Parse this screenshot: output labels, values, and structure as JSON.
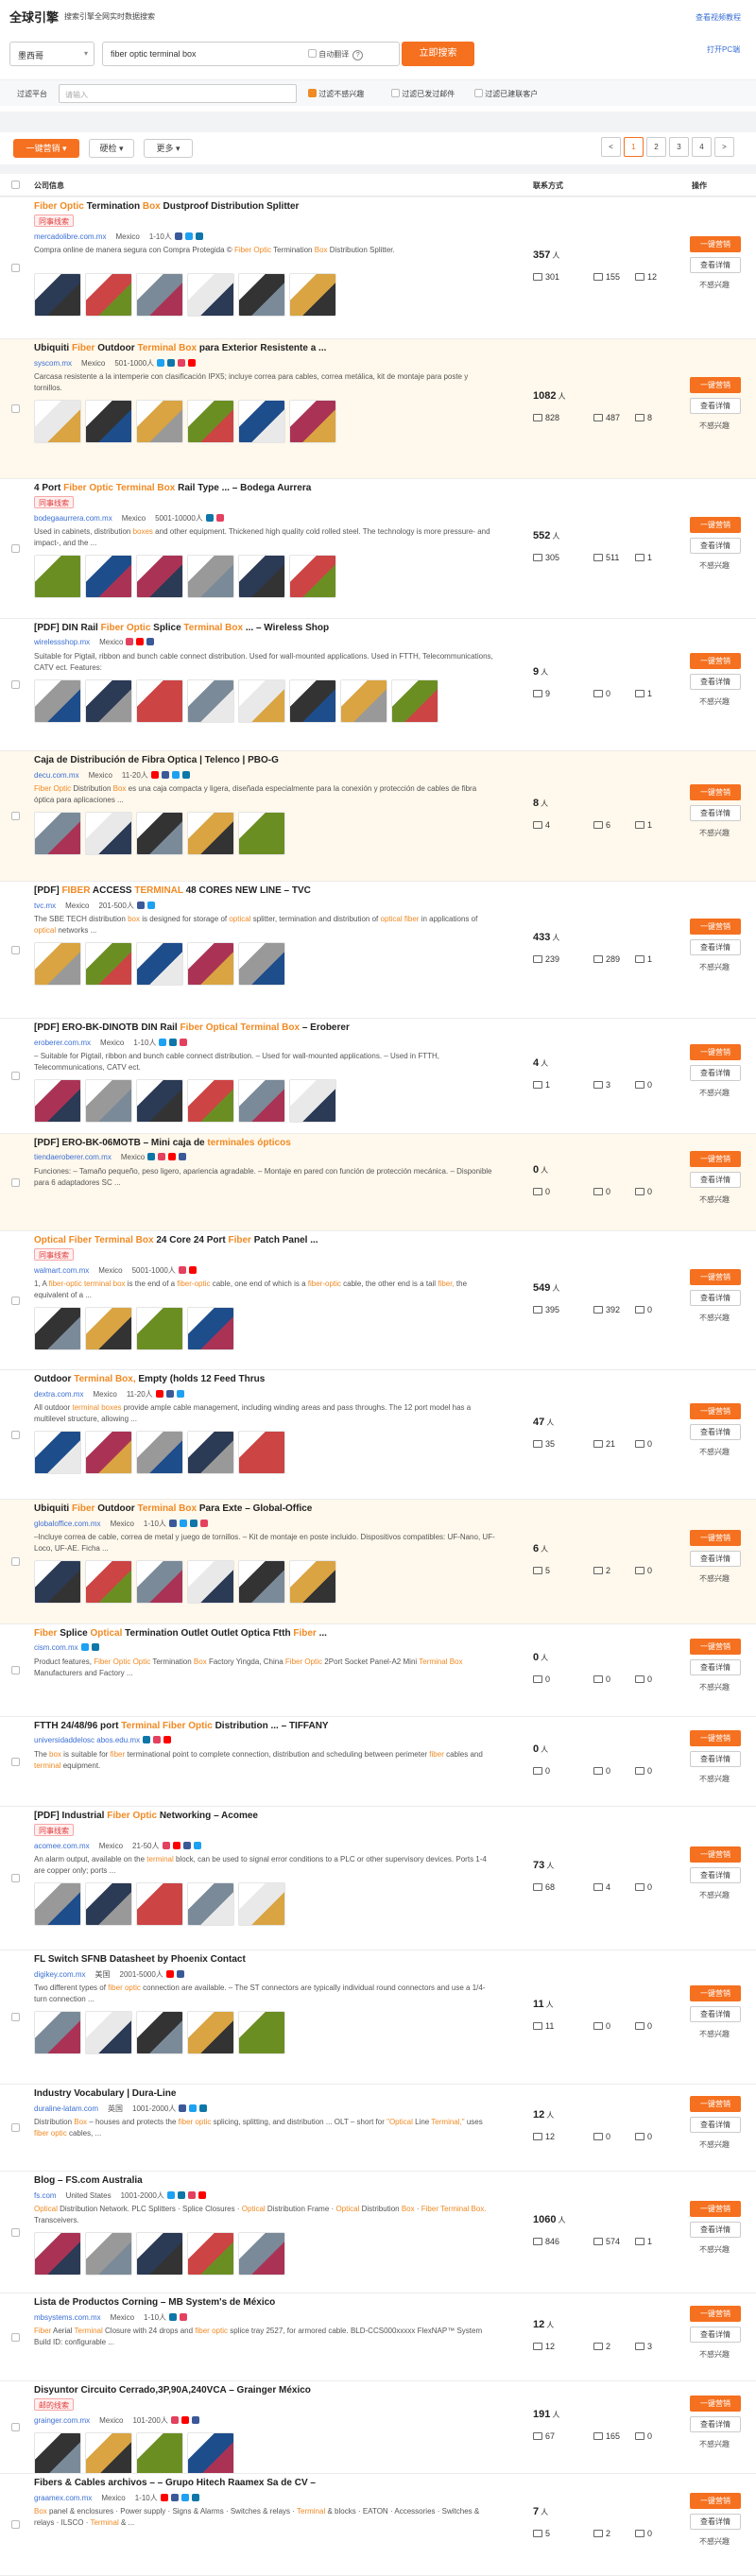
{
  "brand": "全球引擎",
  "brand_sub": "搜索引擎全网实时数据搜索",
  "top_links": {
    "tutorial": "查看视频教程",
    "open_pc": "打开PC端"
  },
  "search": {
    "country": "墨西哥",
    "keyword": "fiber optic terminal box",
    "auto_translate": "自动翻译",
    "button": "立即搜索"
  },
  "filter": {
    "label": "过滤平台",
    "placeholder": "请输入",
    "opt1": "过滤不感兴趣",
    "opt2": "过滤已发过邮件",
    "opt3": "过滤已建联客户"
  },
  "toolbar": {
    "marketing": "一键营销",
    "hard_check": "硬检",
    "more": "更多",
    "pages": [
      "1",
      "2",
      "3",
      "4"
    ],
    "prev": "<",
    "next": ">"
  },
  "table_head": {
    "company": "公司信息",
    "contact": "联系方式",
    "action": "操作"
  },
  "actions": {
    "marketing": "一键营销",
    "view": "查看详情",
    "uninterested": "不感兴趣"
  },
  "count_unit": "人",
  "rows": [
    {
      "title": "Fiber Optic Termination Box Dustproof Distribution Splitter",
      "tag": "同事线索",
      "domain": "mercadolibre.com.mx",
      "country": "Mexico",
      "size": "1-10人",
      "desc": "Compra online de manera segura con Compra Protegida © Fiber Optic Termination Box Distribution Splitter.",
      "count": "357",
      "emails": "301",
      "phones": "155",
      "links": "12"
    },
    {
      "title": "Ubiquiti Fiber Outdoor Terminal Box para Exterior Resistente a ...",
      "tag": "",
      "domain": "syscom.mx",
      "country": "Mexico",
      "size": "501-1000人",
      "desc": "Carcasa resistente a la intemperie con clasificación IPX5; incluye correa para cables, correa metálica, kit de montaje para poste y tornillos.",
      "count": "1082",
      "emails": "828",
      "phones": "487",
      "links": "8"
    },
    {
      "title": "4 Port Fiber Optic Terminal Box Rail Type ... – Bodega Aurrera",
      "tag": "同事线索",
      "domain": "bodegaaurrera.com.mx",
      "country": "Mexico",
      "size": "5001-10000人",
      "desc": "Used in cabinets, distribution boxes and other equipment. Thickened high quality cold rolled steel. The technology is more pressure- and impact-, and the ...",
      "count": "552",
      "emails": "305",
      "phones": "511",
      "links": "1"
    },
    {
      "title": "[PDF] DIN Rail Fiber Optic Splice Terminal Box ... – Wireless Shop",
      "tag": "",
      "domain": "wirelessshop.mx",
      "country": "Mexico",
      "size": "",
      "desc": "Suitable for Pigtail, ribbon and bunch cable connect distribution. Used for wall-mounted applications. Used in FTTH, Telecommunications, CATV ect. Features:",
      "count": "9",
      "emails": "9",
      "phones": "0",
      "links": "1"
    },
    {
      "title": "Caja de Distribución de Fibra Óptica | Telenco | PBO-G",
      "tag": "",
      "domain": "decu.com.mx",
      "country": "Mexico",
      "size": "11-20人",
      "desc": "Fiber Optic Distribution Box es una caja compacta y ligera, diseñada especialmente para la conexión y protección de cables de fibra óptica para aplicaciones ...",
      "count": "8",
      "emails": "4",
      "phones": "6",
      "links": "1"
    },
    {
      "title": "[PDF] FIBER ACCESS TERMINAL 48 CORES NEW LINE – TVC",
      "tag": "",
      "domain": "tvc.mx",
      "country": "Mexico",
      "size": "201-500人",
      "desc": "The SBE TECH distribution box is designed for storage of optical splitter, termination and distribution of optical fiber in applications of optical networks ...",
      "count": "433",
      "emails": "239",
      "phones": "289",
      "links": "1"
    },
    {
      "title": "[PDF] ERO-BK-DINOTB DIN Rail Fiber Optical Terminal Box – Eroberer",
      "tag": "",
      "domain": "eroberer.com.mx",
      "country": "Mexico",
      "size": "1-10人",
      "desc": "– Suitable for Pigtail, ribbon and bunch cable connect distribution. – Used for wall-mounted applications. – Used in FTTH, Telecommunications, CATV ect.",
      "count": "4",
      "emails": "1",
      "phones": "3",
      "links": "0"
    },
    {
      "title": "[PDF] ERO-BK-06MOTB – Mini caja de terminales ópticos",
      "tag": "",
      "domain": "tiendaeroberer.com.mx",
      "country": "Mexico",
      "size": "",
      "desc": "Funciones: – Tamaño pequeño, peso ligero, apariencia agradable. – Montaje en pared con función de protección mecánica. – Disponible para 6 adaptadores SC ...",
      "count": "0",
      "emails": "0",
      "phones": "0",
      "links": "0"
    },
    {
      "title": "Optical Fiber Terminal Box 24 Core 24 Port Fiber Patch Panel ...",
      "tag": "同事线索",
      "domain": "walmart.com.mx",
      "country": "Mexico",
      "size": "5001-1000人",
      "desc": "1, A fiber-optic terminal box is the end of a fiber-optic cable, one end of which is a fiber-optic cable, the other end is a tail fiber, the equivalent of a ...",
      "count": "549",
      "emails": "395",
      "phones": "392",
      "links": "0"
    },
    {
      "title": "Outdoor Terminal Box, Empty (holds 12 Feed Thrus",
      "tag": "",
      "domain": "dextra.com.mx",
      "country": "Mexico",
      "size": "11-20人",
      "desc": "All outdoor terminal boxes provide ample cable management, including winding areas and pass throughs. The 12 port model has a multilevel structure, allowing ...",
      "count": "47",
      "emails": "35",
      "phones": "21",
      "links": "0"
    },
    {
      "title": "Ubiquiti Fiber Outdoor Terminal Box Para Exte – Global-Office",
      "tag": "",
      "domain": "globaloffice.com.mx",
      "country": "Mexico",
      "size": "1-10人",
      "desc": "–Incluye correa de cable, correa de metal y juego de tornillos. – Kit de montaje en poste incluido. Dispositivos compatibles: UF-Nano, UF-Loco, UF-AE. Ficha ...",
      "count": "6",
      "emails": "5",
      "phones": "2",
      "links": "0"
    },
    {
      "title": "Fiber Splice Optical Termination Outlet Outlet Optica Ftth Fiber ...",
      "tag": "",
      "domain": "cism.com.mx",
      "country": "",
      "size": "",
      "desc": "Product features, Fiber Optic Optic Termination Box Factory Yingda, China Fiber Optic 2Port Socket Panel-A2 Mini Terminal Box Manufacturers and Factory ...",
      "count": "0",
      "emails": "0",
      "phones": "0",
      "links": "0"
    },
    {
      "title": "FTTH 24/48/96 port Terminal Fiber Optic Distribution ... – TIFFANY",
      "tag": "",
      "domain": "universidaddelosc abos.edu.mx",
      "country": "",
      "size": "",
      "desc": "The box is suitable for fiber terminational point to complete connection, distribution and scheduling between perimeter fiber cables and terminal equipment.",
      "count": "0",
      "emails": "0",
      "phones": "0",
      "links": "0"
    },
    {
      "title": "[PDF] Industrial Fiber Optic Networking – Acomee",
      "tag": "同事线索",
      "domain": "acomee.com.mx",
      "country": "Mexico",
      "size": "21-50人",
      "desc": "An alarm output, available on the terminal block, can be used to signal error conditions to a PLC or other supervisory devices. Ports 1-4 are copper only; ports ...",
      "count": "73",
      "emails": "68",
      "phones": "4",
      "links": "0"
    },
    {
      "title": "FL Switch SFNB Datasheet by Phoenix Contact",
      "tag": "",
      "domain": "digikey.com.mx",
      "country": "美国",
      "size": "2001-5000人",
      "desc": "Two different types of fiber optic connection are available. – The ST connectors are typically individual round connectors and use a 1/4-turn connection ...",
      "count": "11",
      "emails": "11",
      "phones": "0",
      "links": "0"
    },
    {
      "title": "Industry Vocabulary | Dura-Line",
      "tag": "",
      "domain": "duraline-latam.com",
      "country": "英国",
      "size": "1001-2000人",
      "desc": "Distribution Box – houses and protects the fiber optic splicing, splitting, and distribution ... OLT – short for \"Optical Line Terminal,\" uses fiber optic cables, ...",
      "count": "12",
      "emails": "12",
      "phones": "0",
      "links": "0"
    },
    {
      "title": "Blog – FS.com Australia",
      "tag": "",
      "domain": "fs.com",
      "country": "United States",
      "size": "1001-2000人",
      "desc": "Optical Distribution Network. PLC Splitters · Splice Closures · Optical Distribution Frame · Optical Distribution Box · Fiber Terminal Box. Transceivers.",
      "count": "1060",
      "emails": "846",
      "phones": "574",
      "links": "1"
    },
    {
      "title": "Lista de Productos Corning – MB System's de México",
      "tag": "",
      "domain": "mbsystems.com.mx",
      "country": "Mexico",
      "size": "1-10人",
      "desc": "Fiber Aerial Terminal Closure with 24 drops and fiber optic splice tray 2527, for armored cable. BLD-CCS000xxxxx FlexNAP™ System Build ID: configurable ...",
      "count": "12",
      "emails": "12",
      "phones": "2",
      "links": "3"
    },
    {
      "title": "Disyuntor Circuito Cerrado,3P,90A,240VCA – Grainger México",
      "tag": "邮的线索",
      "domain": "grainger.com.mx",
      "country": "Mexico",
      "size": "101-200人",
      "desc": "",
      "count": "191",
      "emails": "67",
      "phones": "165",
      "links": "0"
    },
    {
      "title": "Fibers & Cables archivos – – Grupo Hitech Raamex Sa de CV –",
      "tag": "",
      "domain": "graamex.com.mx",
      "country": "Mexico",
      "size": "1-10人",
      "desc": "Box panel & enclosures · Power supply · Signs & Alarms · Switches & relays · Terminal & blocks · EATON · Accessories · Switches & relays · ILSCO · Terminal & ...",
      "count": "7",
      "emails": "5",
      "phones": "2",
      "links": "0"
    }
  ],
  "colors": {
    "accent": "#f5701f",
    "link": "#3b6fd4",
    "highlight": "#f08a24",
    "row_highlight": "#fff8ec"
  }
}
